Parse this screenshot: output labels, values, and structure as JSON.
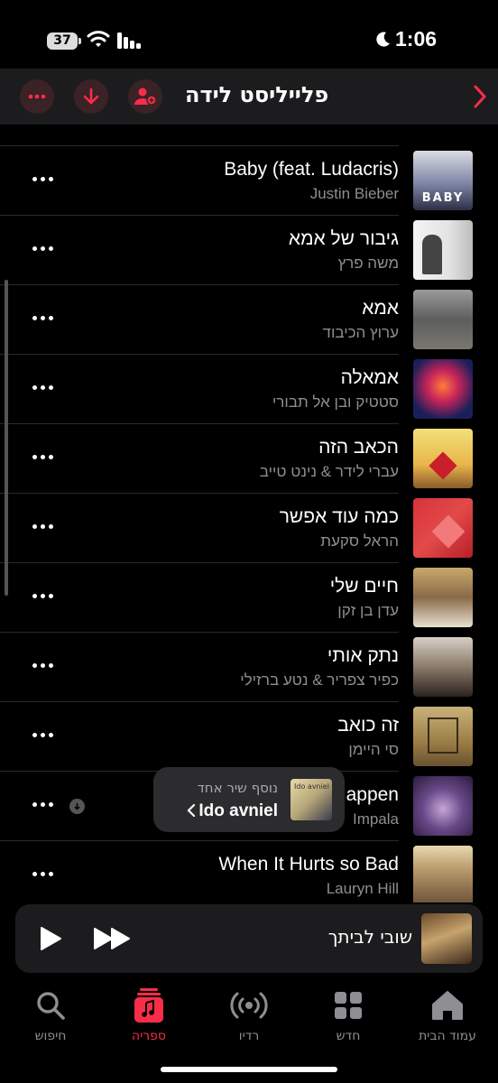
{
  "status_bar": {
    "battery": "37",
    "time": "1:06"
  },
  "header": {
    "title": "פלייליסט לידה"
  },
  "songs": [
    {
      "title": "Baby (feat. Ludacris)",
      "artist": "Justin Bieber"
    },
    {
      "title": "גיבור של אמא",
      "artist": "משה פרץ"
    },
    {
      "title": "אמא",
      "artist": "ערוץ הכיבוד"
    },
    {
      "title": "אמאלה",
      "artist": "סטטיק ובן אל תבורי"
    },
    {
      "title": "הכאב הזה",
      "artist": "עברי לידר & נינט טייב"
    },
    {
      "title": "כמה עוד אפשר",
      "artist": "הראל סקעת"
    },
    {
      "title": "חיים שלי",
      "artist": "עדן בן זקן"
    },
    {
      "title": "נתק אותי",
      "artist": "כפיר צפריר & נטע ברזילי"
    },
    {
      "title": "זה כואב",
      "artist": "סי היימן"
    },
    {
      "title": "appen",
      "artist": "Impala"
    },
    {
      "title": "When It Hurts so Bad",
      "artist": "Lauryn Hill"
    }
  ],
  "toast": {
    "subtitle": "נוסף שיר אחד",
    "playlist": "Ido avniel",
    "art_label": "Ido avniel"
  },
  "mini_player": {
    "title": "שובי לביתך"
  },
  "tabs": [
    {
      "label": "עמוד הבית",
      "icon": "home-icon"
    },
    {
      "label": "חדש",
      "icon": "grid-icon"
    },
    {
      "label": "רדיו",
      "icon": "radio-icon"
    },
    {
      "label": "ספריה",
      "icon": "library-icon",
      "active": true
    },
    {
      "label": "חיפוש",
      "icon": "search-icon"
    }
  ],
  "colors": {
    "accent": "#fa2d48",
    "background": "#000000",
    "header": "#1c1c1e"
  }
}
